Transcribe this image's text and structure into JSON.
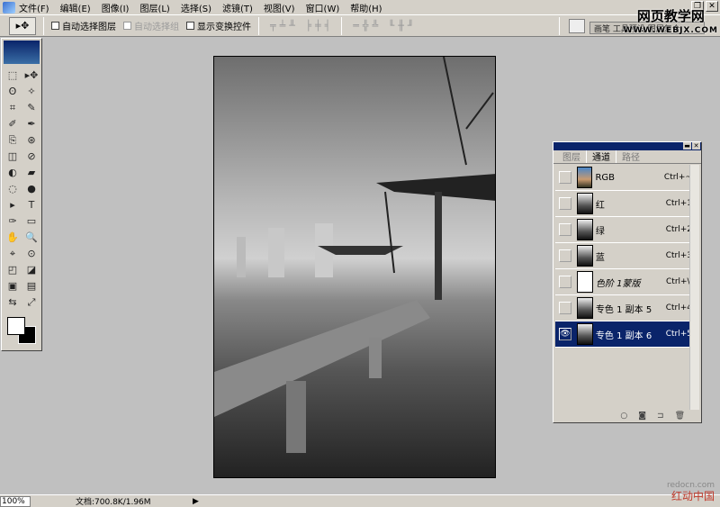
{
  "menu": [
    "文件(F)",
    "编辑(E)",
    "图像(I)",
    "图层(L)",
    "选择(S)",
    "滤镜(T)",
    "视图(V)",
    "窗口(W)",
    "帮助(H)"
  ],
  "options": {
    "tool": "▸✥",
    "auto_select_layer": "自动选择图层",
    "auto_select_group": "自动选择组",
    "show_transform": "显示变换控件",
    "align_icons": "╤╧╨ ╞╪╡",
    "dist_icons": "═╬╩ ╙╫╜"
  },
  "palette_well": {
    "tabs": "画笔  工具预设  图层复合"
  },
  "watermark_top": {
    "line1": "网页教学网",
    "line2": "WWW.WEBJX.COM"
  },
  "toolbox": {
    "tools": [
      "⬚",
      "▸✥",
      "ʘ",
      "✧",
      "⌗",
      "✎",
      "✐",
      "✒",
      "⎘",
      "⊛",
      "◫",
      "⊘",
      "◐",
      "▰",
      "◌",
      "●",
      "▸",
      "T",
      "✑",
      "▭",
      "✋",
      "🔍",
      "⌖",
      "⊙",
      "◰",
      "◪",
      "▣",
      "▤",
      "⇆",
      "⤢"
    ]
  },
  "channels_panel": {
    "tabs": [
      "图层",
      "通道",
      "路径"
    ],
    "active_tab": "通道",
    "channels": [
      {
        "name": "RGB",
        "shortcut": "Ctrl+~",
        "visible": false,
        "thumb": "rgb",
        "italic": false
      },
      {
        "name": "红",
        "shortcut": "Ctrl+1",
        "visible": false,
        "thumb": "gray",
        "italic": false
      },
      {
        "name": "绿",
        "shortcut": "Ctrl+2",
        "visible": false,
        "thumb": "gray",
        "italic": false
      },
      {
        "name": "蓝",
        "shortcut": "Ctrl+3",
        "visible": false,
        "thumb": "gray",
        "italic": false
      },
      {
        "name": "色阶 1蒙版",
        "shortcut": "Ctrl+\\",
        "visible": false,
        "thumb": "white",
        "italic": true
      },
      {
        "name": "专色 1 副本 5",
        "shortcut": "Ctrl+4",
        "visible": false,
        "thumb": "gray",
        "italic": false
      },
      {
        "name": "专色 1 副本 6",
        "shortcut": "Ctrl+5",
        "visible": true,
        "thumb": "gray",
        "italic": false,
        "selected": true
      }
    ],
    "footer_icons": [
      "○",
      "◙",
      "⊐",
      "🗑"
    ]
  },
  "status": {
    "zoom": "100%",
    "doc": "文档:700.8K/1.96M"
  },
  "watermark_bottom": {
    "line1": "redocn.com",
    "line2": "红动中国"
  }
}
